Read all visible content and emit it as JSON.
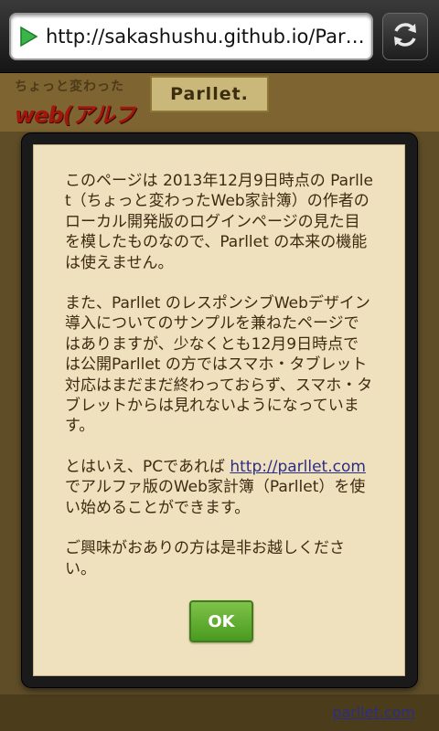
{
  "browser": {
    "url": "http://sakashushu.github.io/Parllet/",
    "icons": {
      "play": "play-icon",
      "refresh": "refresh-icon"
    }
  },
  "header": {
    "logo_line1": "ちょっと変わった",
    "logo_line2": "web(アルファ)版",
    "parllet_logo": "Parllet."
  },
  "modal": {
    "para1": "このページは 2013年12月9日時点の Parllet（ちょっと変わったWeb家計簿）の作者のローカル開発版のログインページの見た目を模したものなので、Parllet の本来の機能は使えません。",
    "para2": "また、Parllet のレスポンシブWebデザイン導入についてのサンプルを兼ねたページではありますが、少なくとも12月9日時点では公開Parllet の方ではスマホ・タブレット対応はまだまだ終わっておらず、スマホ・タブレットからは見れないようになっています。",
    "para3_before": "とはいえ、PCであれば ",
    "para3_link": "http://parllet.com",
    "para3_after": " でアルファ版のWeb家計簿（Parllet）を使い始めることができます。",
    "para4": "ご興味がおありの方は是非お越しください。",
    "ok_label": "OK"
  },
  "footer": {
    "link": "parllet.com"
  },
  "colors": {
    "modal_bg": "#f0e1be",
    "text": "#3f2a12",
    "link": "#2c2d86",
    "ok_green": "#5aaa2a",
    "page_brown": "#5f4d28"
  }
}
